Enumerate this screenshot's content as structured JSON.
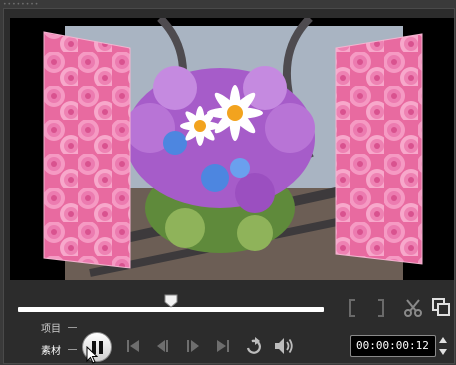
{
  "player": {
    "grip_dots": "••••••••",
    "preview_image": "flower-bouquet-3d-page-turn",
    "labels": {
      "project": "项目",
      "clip": "素材"
    },
    "active_mode": "clip",
    "timecode": "00:00:00:",
    "timecode_frames": "12",
    "playback_state": "paused",
    "icons": {
      "mark_in": "mark-in-bracket-icon",
      "mark_out": "mark-out-bracket-icon",
      "cut": "scissors-icon",
      "enlarge": "enlarge-preview-icon",
      "home": "go-to-start-icon",
      "prev": "previous-frame-icon",
      "next": "next-frame-icon",
      "end": "go-to-end-icon",
      "repeat": "repeat-icon",
      "volume": "volume-icon",
      "pause": "pause-icon",
      "cursor": "mouse-pointer-icon"
    },
    "colors": {
      "accent": "#ffffff",
      "background": "#2c2c2c",
      "preview_bg": "#000000"
    }
  }
}
